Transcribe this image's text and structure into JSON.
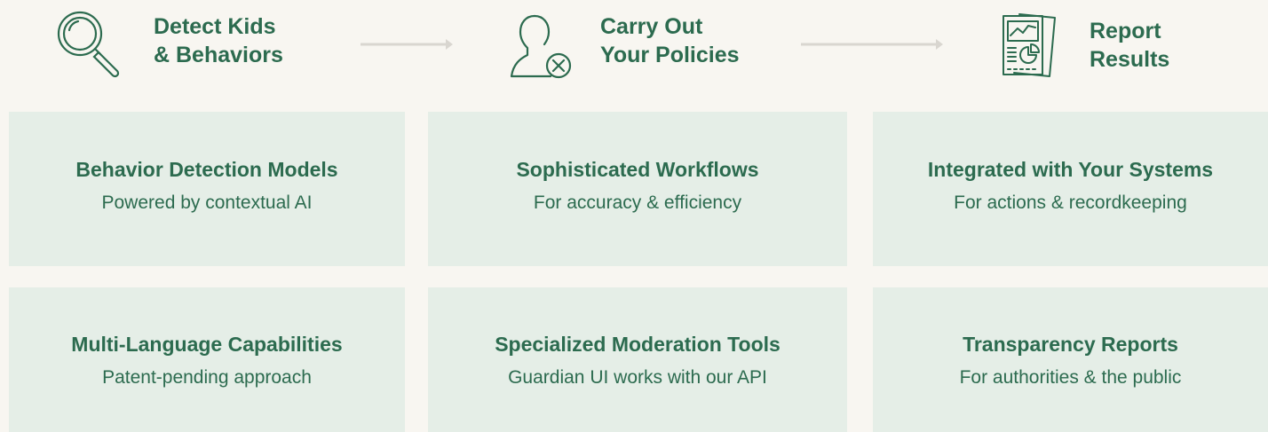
{
  "steps": [
    {
      "icon": "magnifier-icon",
      "line1": "Detect Kids",
      "line2": "& Behaviors"
    },
    {
      "icon": "user-block-icon",
      "line1": "Carry Out",
      "line2": "Your Policies"
    },
    {
      "icon": "report-icon",
      "line1": "Report",
      "line2": "Results"
    }
  ],
  "cards": [
    {
      "title": "Behavior Detection Models",
      "subtitle": "Powered by contextual AI"
    },
    {
      "title": "Sophisticated Workflows",
      "subtitle": "For accuracy & efficiency"
    },
    {
      "title": "Integrated with Your Systems",
      "subtitle": "For actions & recordkeeping"
    },
    {
      "title": "Multi-Language Capabilities",
      "subtitle": "Patent-pending approach"
    },
    {
      "title": "Specialized Moderation Tools",
      "subtitle": "Guardian UI works with our API"
    },
    {
      "title": "Transparency Reports",
      "subtitle": "For authorities & the public"
    }
  ],
  "colors": {
    "background": "#f8f6f1",
    "card": "#e5eee7",
    "text": "#2c6b4f",
    "arrow": "#d9d6d0"
  }
}
